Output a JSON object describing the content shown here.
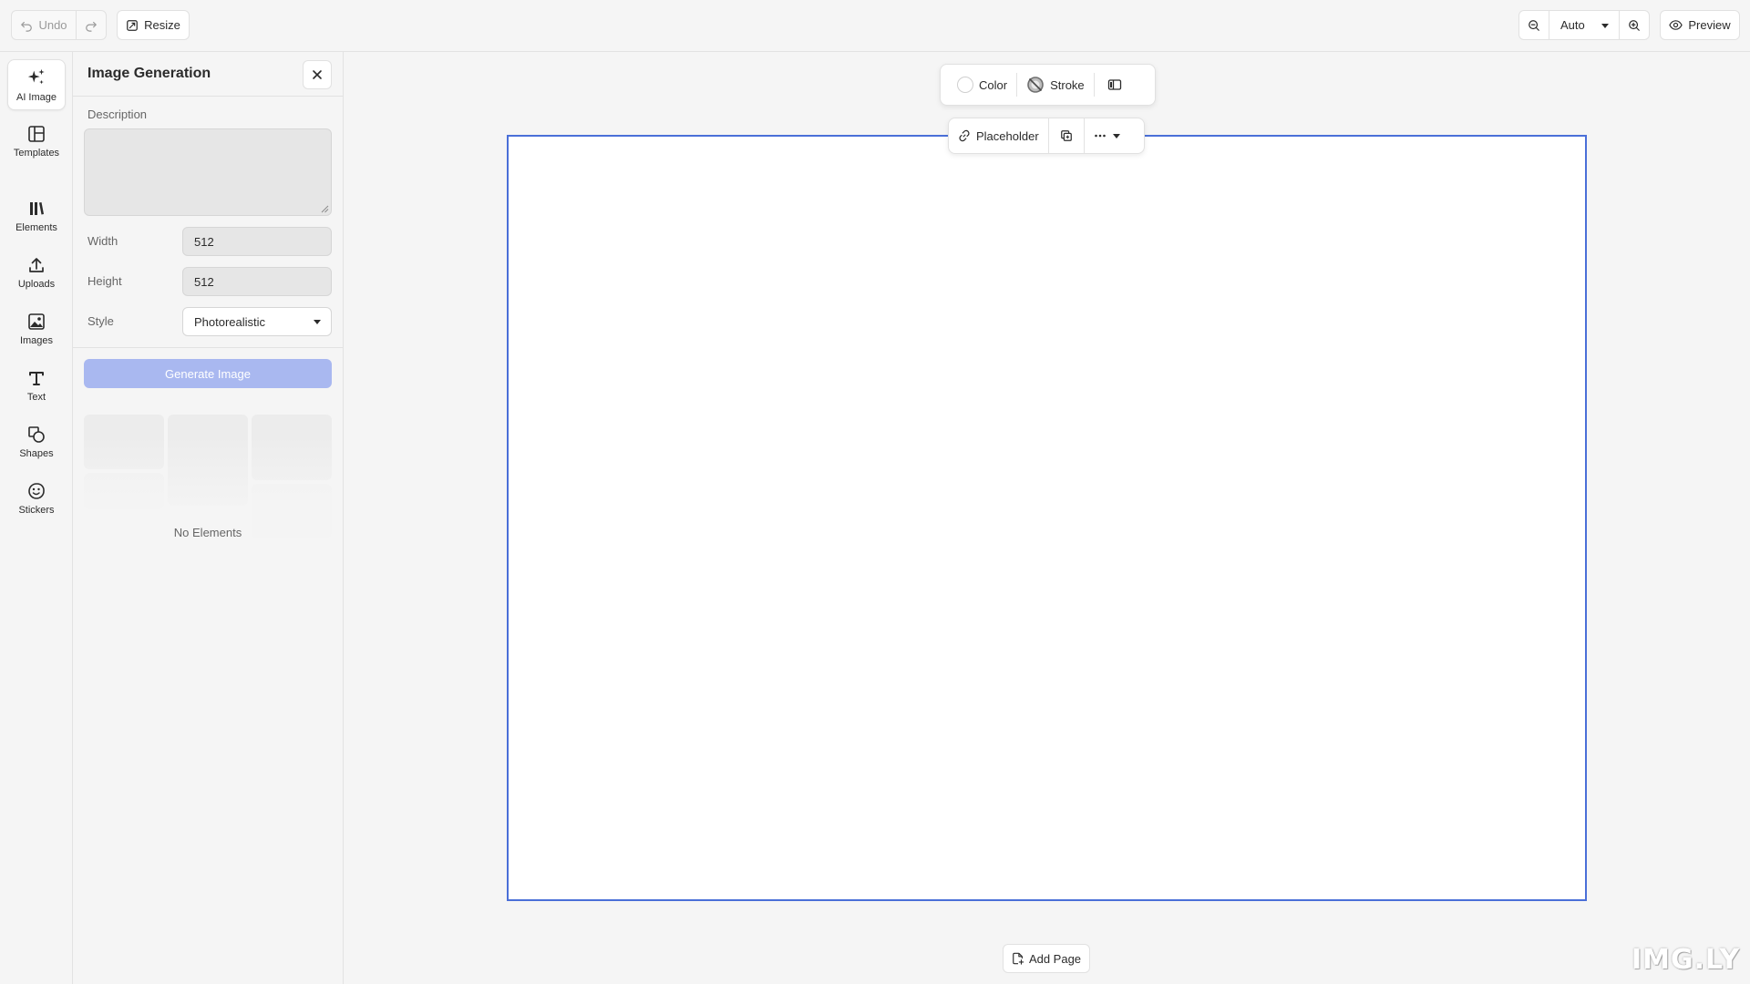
{
  "toolbar": {
    "undo_label": "Undo",
    "resize_label": "Resize",
    "zoom_value": "Auto",
    "preview_label": "Preview"
  },
  "rail": {
    "items": [
      {
        "label": "AI Image",
        "icon": "sparkles-icon",
        "active": true
      },
      {
        "label": "Templates",
        "icon": "template-icon"
      },
      {
        "label": "Elements",
        "icon": "library-icon"
      },
      {
        "label": "Uploads",
        "icon": "upload-icon"
      },
      {
        "label": "Images",
        "icon": "image-icon"
      },
      {
        "label": "Text",
        "icon": "text-icon"
      },
      {
        "label": "Shapes",
        "icon": "shapes-icon"
      },
      {
        "label": "Stickers",
        "icon": "sticker-icon"
      }
    ]
  },
  "panel": {
    "title": "Image Generation",
    "description_label": "Description",
    "description_value": "",
    "width_label": "Width",
    "width_value": "512",
    "height_label": "Height",
    "height_value": "512",
    "style_label": "Style",
    "style_value": "Photorealistic",
    "generate_label": "Generate Image",
    "empty_label": "No Elements"
  },
  "canvas": {
    "fill_label": "Color",
    "stroke_label": "Stroke",
    "placeholder_label": "Placeholder",
    "add_page_label": "Add Page",
    "selection_color": "#4a6fd8"
  },
  "watermark": "IMG.LY",
  "colors": {
    "accent": "#4a6fd8",
    "generate_disabled": "#a9b8f0"
  }
}
